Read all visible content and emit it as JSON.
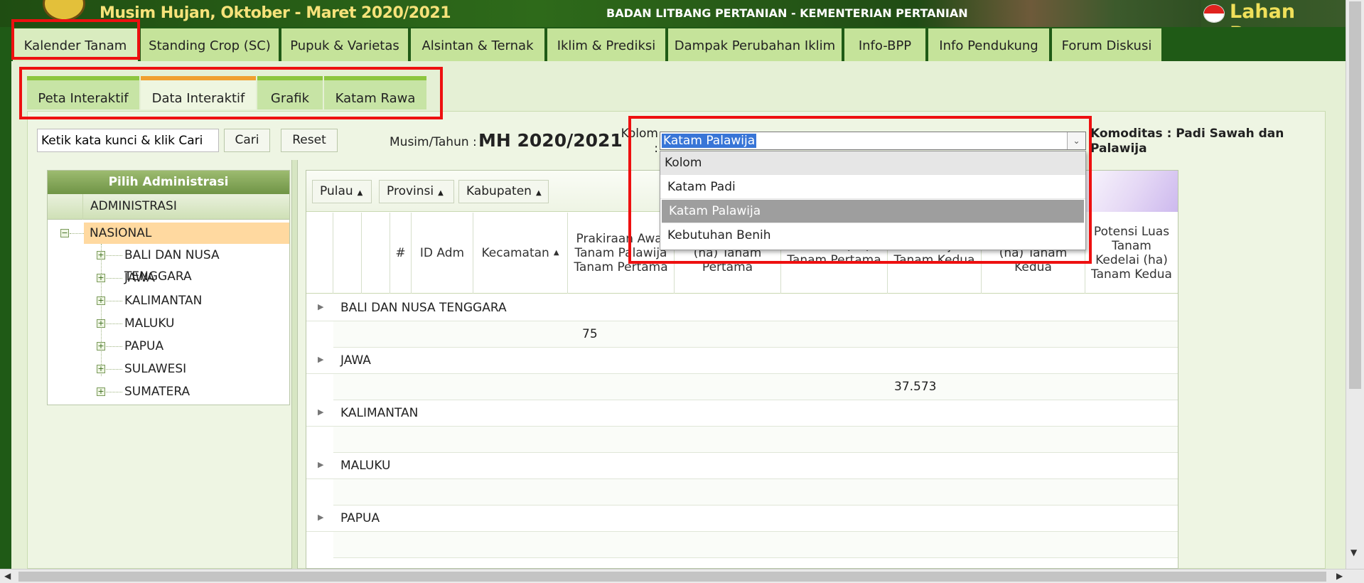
{
  "banner": {
    "season_title": "Musim Hujan, Oktober - Maret 2020/2021",
    "agency": "BADAN LITBANG PERTANIAN - KEMENTERIAN PERTANIAN",
    "brand": "Lahan Rawa"
  },
  "main_tabs": [
    {
      "label": "Kalender Tanam",
      "active": true
    },
    {
      "label": "Standing Crop (SC)"
    },
    {
      "label": "Pupuk & Varietas"
    },
    {
      "label": "Alsintan & Ternak"
    },
    {
      "label": "Iklim & Prediksi"
    },
    {
      "label": "Dampak Perubahan Iklim"
    },
    {
      "label": "Info-BPP"
    },
    {
      "label": "Info Pendukung"
    },
    {
      "label": "Forum Diskusi"
    }
  ],
  "sub_tabs": [
    {
      "label": "Peta Interaktif"
    },
    {
      "label": "Data Interaktif",
      "active": true
    },
    {
      "label": "Grafik"
    },
    {
      "label": "Katam Rawa"
    }
  ],
  "search": {
    "value": "Ketik kata kunci & klik Cari",
    "search_button": "Cari",
    "reset_button": "Reset"
  },
  "season": {
    "label": "Musim/Tahun :",
    "value": "MH 2020/2021"
  },
  "kolom": {
    "label": "Kolom :",
    "selected": "Katam Palawija",
    "options": [
      "Kolom",
      "Katam Padi",
      "Katam Palawija",
      "Kebutuhan Benih"
    ]
  },
  "komoditas": "Komoditas : Padi Sawah dan Palawija",
  "tree": {
    "header": "Pilih Administrasi",
    "column": "ADMINISTRASI",
    "root": "NASIONAL",
    "items": [
      "BALI DAN NUSA TENGGARA",
      "JAWA",
      "KALIMANTAN",
      "MALUKU",
      "PAPUA",
      "SULAWESI",
      "SUMATERA"
    ]
  },
  "grid": {
    "toolbar": [
      "Pulau",
      "Provinsi",
      "Kabupaten"
    ],
    "columns": {
      "num": "#",
      "id": "ID Adm",
      "kec": "Kecamatan",
      "c1": "Prakiraan Awal Tanam Palawija Tanam Pertama",
      "c2": "Jagung/Kedelai (ha) Tanam Pertama",
      "c3": "Kedelai (ha) Tanam Pertama",
      "c4": "Palawija Tanam Kedua",
      "c5": "Jagung/Kedelai (ha) Tanam Kedua",
      "c6": "Potensi Luas Tanam Kedelai (ha) Tanam Kedua"
    },
    "groups": [
      {
        "name": "BALI DAN NUSA TENGGARA",
        "value": "75"
      },
      {
        "name": "JAWA",
        "value": "37.573"
      },
      {
        "name": "KALIMANTAN",
        "value": ""
      },
      {
        "name": "MALUKU",
        "value": ""
      },
      {
        "name": "PAPUA",
        "value": ""
      }
    ]
  }
}
